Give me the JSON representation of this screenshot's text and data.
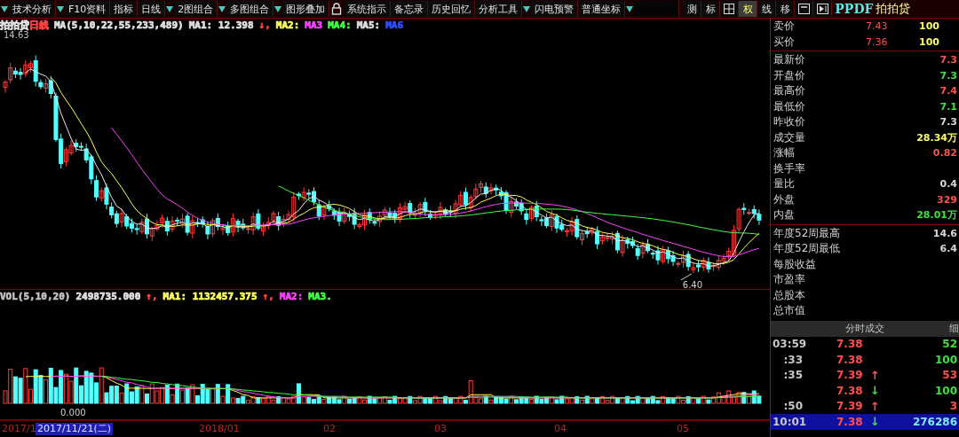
{
  "toolbar": {
    "items": [
      {
        "kind": "text",
        "label": "技术分析",
        "dropdown": true
      },
      {
        "kind": "text",
        "label": "F10资料",
        "dropdown": true
      },
      {
        "kind": "text",
        "label": "指标",
        "dropdown": false
      },
      {
        "kind": "text",
        "label": "日线",
        "dropdown": false
      },
      {
        "kind": "text",
        "label": "2图组合",
        "dropdown": true
      },
      {
        "kind": "text",
        "label": "多图组合",
        "dropdown": true
      },
      {
        "kind": "text",
        "label": "图形叠加",
        "dropdown": true
      },
      {
        "kind": "lock"
      },
      {
        "kind": "text",
        "label": "系统指示",
        "dropdown": false
      },
      {
        "kind": "text",
        "label": "备忘录",
        "dropdown": false
      },
      {
        "kind": "text",
        "label": "历史回忆",
        "dropdown": false
      },
      {
        "kind": "text",
        "label": "分析工具",
        "dropdown": false
      },
      {
        "kind": "text",
        "label": "闪电预警",
        "dropdown": true
      },
      {
        "kind": "text",
        "label": "普通坐标",
        "dropdown": false
      },
      {
        "kind": "field",
        "dropdown": true
      }
    ],
    "tools": [
      {
        "kind": "text",
        "label": "测",
        "selected": false
      },
      {
        "kind": "text",
        "label": "标",
        "selected": false
      },
      {
        "kind": "grid",
        "selected": false
      },
      {
        "kind": "text",
        "label": "权",
        "selected": true
      },
      {
        "kind": "text",
        "label": "线",
        "selected": false
      },
      {
        "kind": "text",
        "label": "移",
        "selected": false
      },
      {
        "kind": "window",
        "selected": false
      },
      {
        "kind": "play",
        "selected": false
      }
    ]
  },
  "price_chart": {
    "name": "拍拍贷",
    "period": "日线",
    "legend": [
      {
        "text": "MA(5,10,22,55,233,489)",
        "color": "#e0e0e0"
      },
      {
        "text": "MA1: 12.398",
        "color": "#e0e0e0"
      },
      {
        "text": "↓,",
        "color": "#ff4040"
      },
      {
        "text": "MA2:",
        "color": "#ffff60"
      },
      {
        "text": "MA3",
        "color": "#ff40ff"
      },
      {
        "text": "MA4:",
        "color": "#40ff40"
      },
      {
        "text": "MA5:",
        "color": "#e0e0e0"
      },
      {
        "text": "MA6",
        "color": "#3050ff"
      }
    ],
    "high_label": "14.63",
    "low_label": "6.40"
  },
  "volume_chart": {
    "legend": [
      {
        "text": "VOL(5,10,20)",
        "color": "#c0c0c0"
      },
      {
        "text": "2498735.000",
        "color": "#e0e0e0"
      },
      {
        "text": "↑,",
        "color": "#ff4040"
      },
      {
        "text": "MA1: 1132457.375",
        "color": "#ffff60"
      },
      {
        "text": "↑,",
        "color": "#ff4040"
      },
      {
        "text": "MA2:",
        "color": "#ff40ff"
      },
      {
        "text": "MA3.",
        "color": "#40ff40"
      }
    ],
    "zero_label": "0.000"
  },
  "date_axis": [
    {
      "label": "2017/1",
      "selected": false
    },
    {
      "label": "2017/11/21(二)",
      "selected": true
    },
    {
      "label": "2018/01",
      "selected": false
    },
    {
      "label": "02",
      "selected": false
    },
    {
      "label": "03",
      "selected": false
    },
    {
      "label": "04",
      "selected": false
    },
    {
      "label": "05",
      "selected": false
    }
  ],
  "quote_panel": {
    "code": "PPDF",
    "name": "拍拍贷",
    "order_book": [
      {
        "label": "卖价",
        "price": "7.43",
        "volume": "100"
      },
      {
        "label": "买价",
        "price": "7.36",
        "volume": "100"
      }
    ],
    "stats": [
      {
        "label": "最新价",
        "value": "7.3",
        "color": "#ff5050"
      },
      {
        "label": "开盘价",
        "value": "7.3",
        "color": "#40e040"
      },
      {
        "label": "最高价",
        "value": "7.4",
        "color": "#ff5050"
      },
      {
        "label": "最低价",
        "value": "7.1",
        "color": "#40e040"
      },
      {
        "label": "昨收价",
        "value": "7.3",
        "color": "#d8d8d8"
      },
      {
        "label": "成交量",
        "value": "28.34万",
        "color": "#ffff60"
      },
      {
        "label": "涨幅",
        "value": "0.82",
        "color": "#ff5050"
      },
      {
        "label": "换手率"
      },
      {
        "label": "量比",
        "value": "0.4",
        "color": "#d8d8d8"
      },
      {
        "label": "外盘",
        "value": "329",
        "color": "#ff5050"
      },
      {
        "label": "内盘",
        "value": "28.01万",
        "color": "#40e040"
      }
    ],
    "fundamentals": [
      {
        "label": "年度52周最高",
        "value": "14.6"
      },
      {
        "label": "年度52周最低",
        "value": "6.4"
      },
      {
        "label": "每股收益"
      },
      {
        "label": "市盈率"
      },
      {
        "label": "总股本"
      },
      {
        "label": "总市值"
      }
    ]
  },
  "trades": {
    "title": "分时成交",
    "column_cut": "细",
    "rows": [
      {
        "time": "03:59",
        "price": "7.38",
        "volume": "52",
        "color": "#40e040",
        "selected": false
      },
      {
        "time": ":33",
        "price": "7.38",
        "volume": "100",
        "color": "#40e040",
        "selected": false
      },
      {
        "time": ":35",
        "price": "7.39",
        "arrow": {
          "symbol": "↑",
          "color": "#ff5050"
        },
        "volume": "53",
        "color": "#ff5050",
        "selected": false
      },
      {
        "price": "7.38",
        "arrow": {
          "symbol": "↓",
          "color": "#40e040"
        },
        "volume": "100",
        "color": "#40e040",
        "selected": false
      },
      {
        "time": ":50",
        "price": "7.39",
        "arrow": {
          "symbol": "↑",
          "color": "#ff5050"
        },
        "volume": "3",
        "color": "#ff5050",
        "selected": false
      },
      {
        "time": "10:01",
        "price": "7.38",
        "arrow": {
          "symbol": "↓",
          "color": "#40e040"
        },
        "volume": "276286",
        "color": "#7fe8ff",
        "selected": true
      }
    ]
  }
}
